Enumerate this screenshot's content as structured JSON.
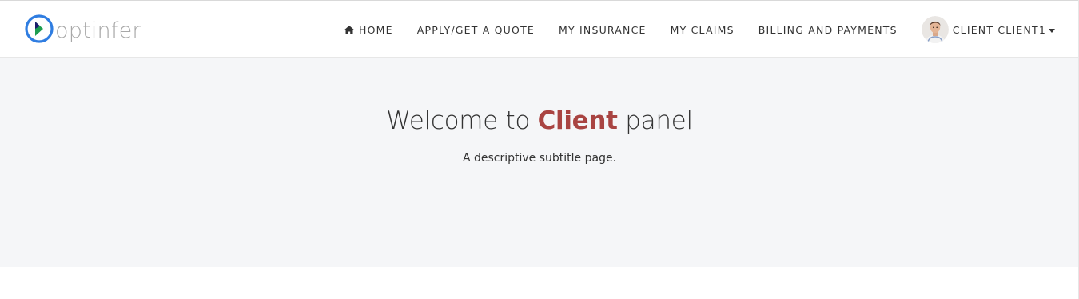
{
  "brand": {
    "name": "optinfer",
    "logo_icon": "optinfer-logo-icon"
  },
  "nav": {
    "items": [
      {
        "label": "HOME",
        "icon": "home-icon"
      },
      {
        "label": "APPLY/GET A QUOTE"
      },
      {
        "label": "MY INSURANCE"
      },
      {
        "label": "MY CLAIMS"
      },
      {
        "label": "BILLING AND PAYMENTS"
      }
    ],
    "user": {
      "label": "CLIENT CLIENT1",
      "icon": "chevron-down-icon"
    }
  },
  "hero": {
    "title_prefix": "Welcome to ",
    "title_accent": "Client",
    "title_suffix": " panel",
    "subtitle": "A descriptive subtitle page."
  },
  "colors": {
    "accent": "#a94442",
    "hero_background": "#f5f6f8",
    "logo_blue": "#2f7de1",
    "logo_green": "#1e9e50"
  }
}
